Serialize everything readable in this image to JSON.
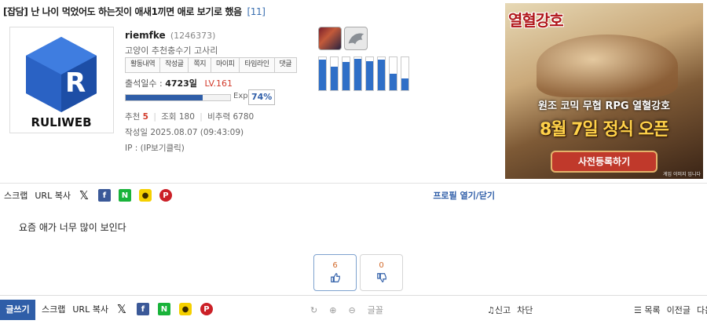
{
  "post": {
    "category": "[잡담]",
    "title": "난 나이 먹었어도 하는짓이 애새1끼면 애로 보기로 했음",
    "comment_count": "[11]",
    "body": "요즘 애가 너무 많이 보인다"
  },
  "logo": {
    "text": "RULIWEB",
    "letter": "R"
  },
  "author": {
    "name": "riemfke",
    "id": "(1246373)",
    "rank": "고양이 추천충수기 고사리",
    "tabs": [
      "활동내역",
      "작성글",
      "쪽지",
      "마이피",
      "타임라인",
      "댓글"
    ],
    "attend_label": "출석일수 :",
    "attend_days": "4723일",
    "level": "LV.161",
    "exp_label": "Exp.",
    "exp_percent": "74%",
    "exp_fraction": 0.74,
    "recommend_label": "추천",
    "recommend": "5",
    "views": "조회 180",
    "ratio": "비추력 6780",
    "date": "작성일 2025.08.07 (09:43:09)",
    "ip": "IP : (IP보기클릭)"
  },
  "activity_bars": [
    0.92,
    0.72,
    0.85,
    0.95,
    0.88,
    0.92,
    0.5,
    0.35
  ],
  "share": {
    "scrap": "스크랩",
    "url_copy": "URL 복사",
    "icons": [
      "x-icon",
      "facebook-icon",
      "naver-icon",
      "kakao-icon",
      "pinterest-icon"
    ],
    "x_glyph": "𝕏",
    "fb_glyph": "f",
    "naver_glyph": "N",
    "kakao_glyph": "●",
    "pin_glyph": "P"
  },
  "profile_toggle": "프로필 열기/닫기",
  "ad": {
    "logo": "열혈강호",
    "subtitle": "원조 코믹 무협 RPG 열혈강호",
    "headline": "8월 7일 정식 오픈",
    "cta": "사전등록하기",
    "fineprint": "게임 이미지 입니다"
  },
  "votes": {
    "up": "6",
    "down": "0"
  },
  "bottom": {
    "write": "글쓰기",
    "scrap": "스크랩",
    "url_copy": "URL 복사",
    "refresh": "↻",
    "zoom_in": "⊕",
    "zoom_out": "⊖",
    "font_label": "글꼴",
    "report": "신고",
    "block": "차단",
    "list": "목록",
    "prev": "이전글",
    "next": "다음"
  },
  "colors": {
    "accent": "#2f5ea8",
    "red": "#d23a2a",
    "vote_count": "#d2692a"
  }
}
